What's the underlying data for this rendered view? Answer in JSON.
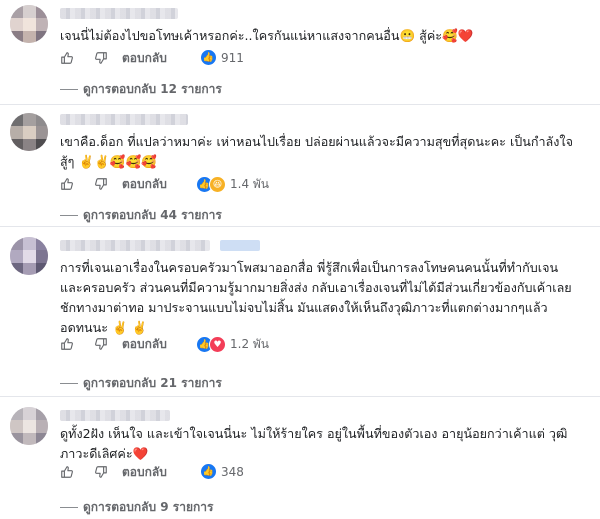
{
  "colors": {
    "like_blue": "#1877f2",
    "love_red": "#f33e58",
    "haha_yellow": "#f7b125",
    "muted": "#65676b"
  },
  "actions": {
    "reply_label": "ตอบกลับ"
  },
  "comments": [
    {
      "text": "เจนนี่ไม่ต้องไปขอโทษเค้าหรอกค่ะ..ใครกันแน่หาแสงจากคนอื่น😬 สู้ค่ะ🥰❤️",
      "reaction_count": "911",
      "reactions": [
        "like-icon"
      ],
      "replies": "ดูการตอบกลับ 12 รายการ"
    },
    {
      "text": "เขาคือ.ด็อก ที่แปลว่าหมาค่ะ เห่าหอนไปเรื่อย ปล่อยผ่านแล้วจะมีความสุขที่สุดนะคะ เป็นกำลังใจสู้ๆ ✌️✌️🥰🥰🥰",
      "reaction_count": "1.4 พัน",
      "reactions": [
        "like-icon",
        "haha-icon"
      ],
      "replies": "ดูการตอบกลับ 44 รายการ"
    },
    {
      "text": "การที่เจนเอาเรื่องในครอบครัวมาโพสมาออกสื่อ พี่รู้สึกเพื่อเป็นการลงโทษคนคนนั้นที่ทำกับเจนและครอบครัว ส่วนคนที่มีความรู้มากมายสิ่งส่ง กลับเอาเรื่องเจนที่ไม่ได้มีส่วนเกี่ยวข้องกับเค้าเลยชักทางมาต่าทอ มาประจานแบบไม่จบไม่สิ้น มันแสดงให้เห็นถึงวุฒิภาวะที่แตกต่างมากๆแล้ว อดทนนะ ✌️ ✌️",
      "reaction_count": "1.2 พัน",
      "reactions": [
        "like-icon",
        "love-icon"
      ],
      "replies": "ดูการตอบกลับ 21 รายการ"
    },
    {
      "text": "ดูทั้ง2ฝัง เห็นใจ และเข้าใจเจนนี่นะ ไม่ให้ร้ายใคร อยู่ในพื้นที่ของตัวเอง อายุน้อยกว่าเค้าแต่ วุฒิภาวะดีเลิศค่ะ❤️",
      "reaction_count": "348",
      "reactions": [
        "like-icon"
      ],
      "replies": "ดูการตอบกลับ 9 รายการ"
    }
  ]
}
